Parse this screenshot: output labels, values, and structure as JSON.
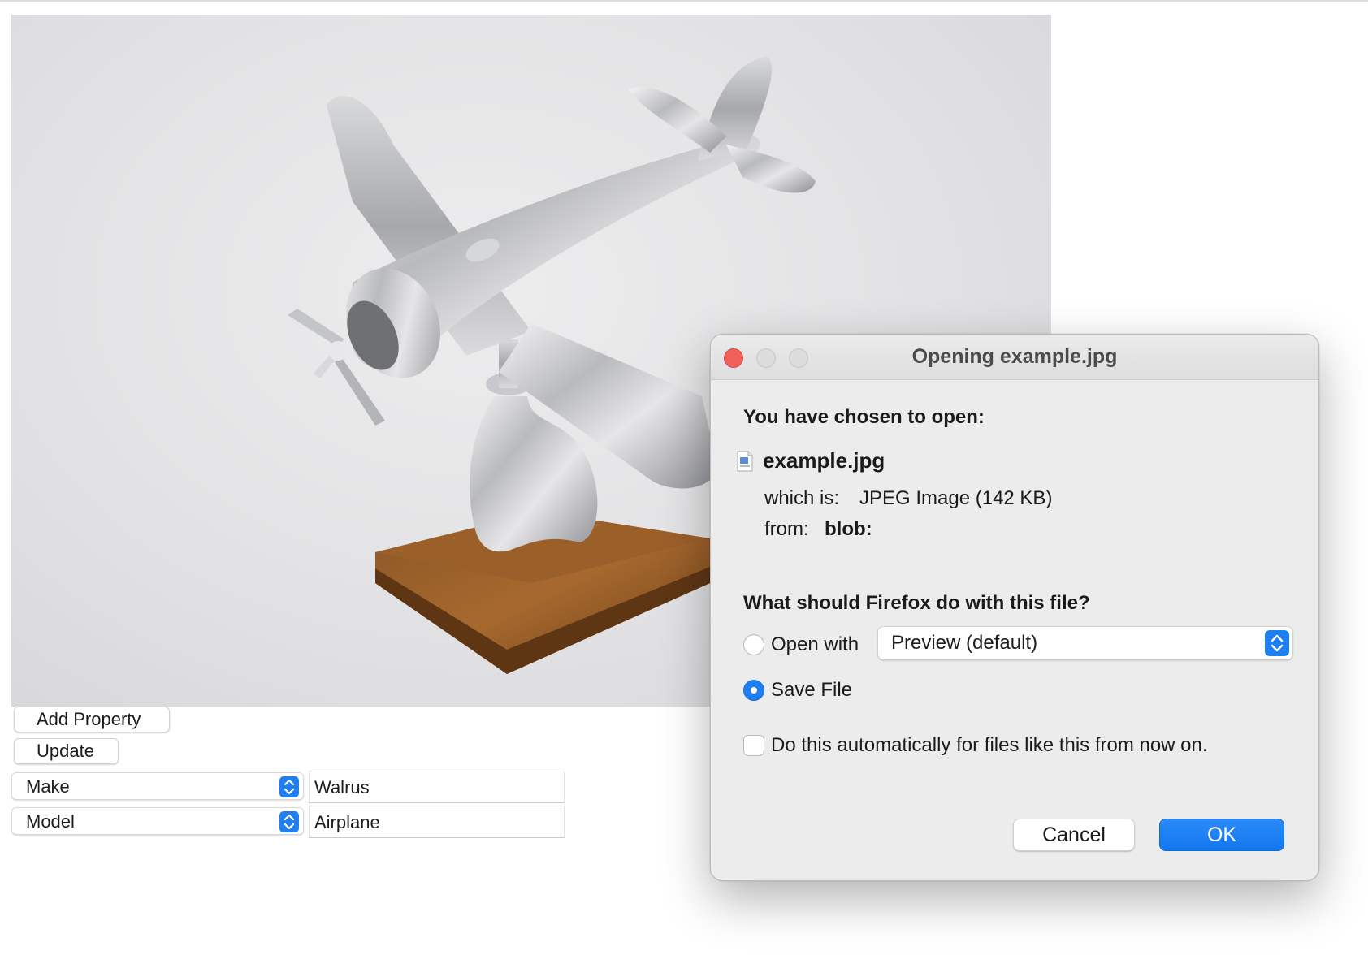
{
  "page": {
    "add_property_label": "Add Property",
    "update_label": "Update",
    "properties": [
      {
        "key": "Make",
        "value": "Walrus"
      },
      {
        "key": "Model",
        "value": "Airplane"
      }
    ]
  },
  "photo": {
    "subject": "aluminium airplane model on seal-shaped stand with wooden base"
  },
  "dialog": {
    "title": "Opening example.jpg",
    "chosen_heading": "You have chosen to open:",
    "filename": "example.jpg",
    "which_is_label": "which is:",
    "which_is_value": "JPEG Image (142 KB)",
    "from_label": "from:",
    "from_value": "blob:",
    "question": "What should Firefox do with this file?",
    "open_with_label": "Open with",
    "open_with_app": "Preview (default)",
    "open_with_selected": false,
    "save_file_label": "Save File",
    "save_file_selected": true,
    "auto_label": "Do this automatically for files like this from now on.",
    "auto_checked": false,
    "cancel_label": "Cancel",
    "ok_label": "OK"
  },
  "colors": {
    "accent": "#1f7ff2",
    "close_light": "#f0605a",
    "dialog_bg": "#ececec"
  }
}
